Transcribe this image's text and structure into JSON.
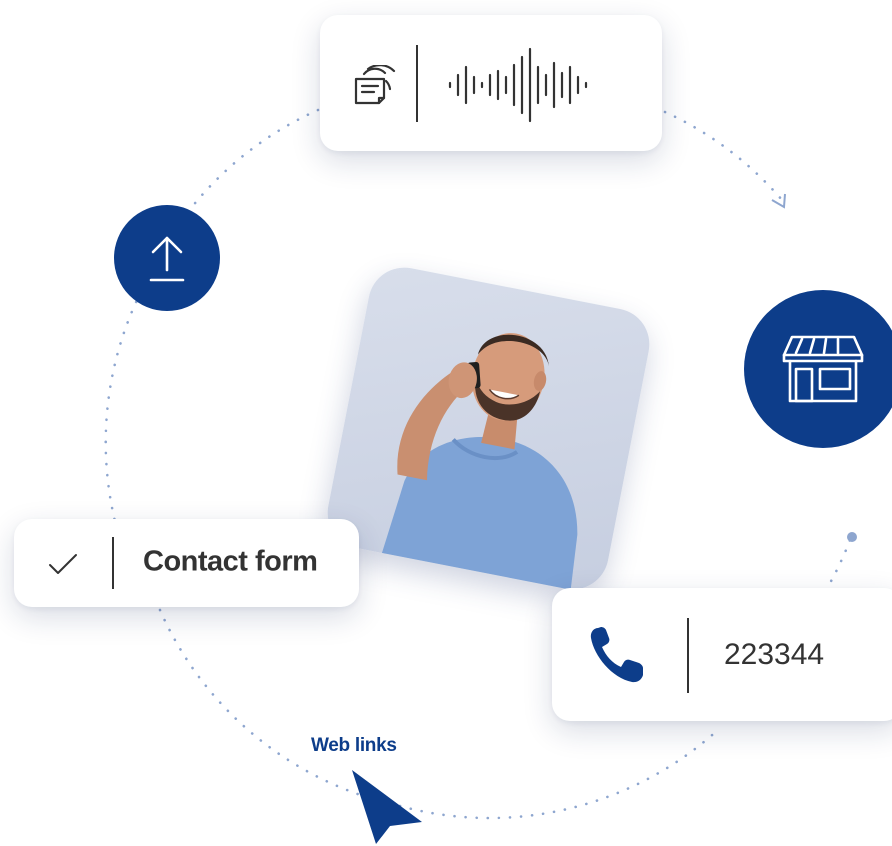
{
  "colors": {
    "brand_blue": "#0d3d8a",
    "dot_blue": "#8ea6cf",
    "text_dark": "#333333",
    "card_bg": "#ffffff"
  },
  "audio_card": {
    "transcript_icon": "transcript-icon",
    "waveform_icon": "audio-waveform-icon"
  },
  "upload_badge": {
    "icon": "upload-icon"
  },
  "store_badge": {
    "icon": "storefront-icon"
  },
  "photo": {
    "subject": "man talking on phone"
  },
  "contact_card": {
    "icon": "checkmark-icon",
    "label": "Contact form"
  },
  "phone_card": {
    "icon": "phone-icon",
    "number": "223344"
  },
  "web_links": {
    "label": "Web links",
    "icon": "cursor-arrow-icon"
  }
}
